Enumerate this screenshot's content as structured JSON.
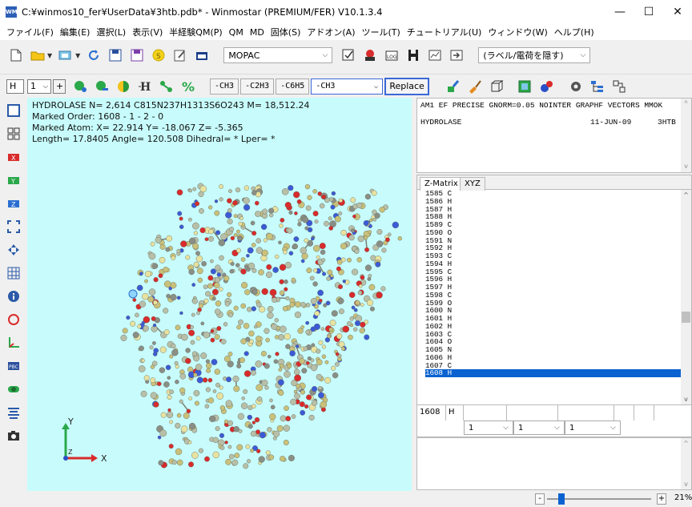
{
  "window": {
    "title": "C:¥winmos10_fer¥UserData¥3htb.pdb* - Winmostar (PREMIUM/FER) V10.1.3.4",
    "icon_label": "WM",
    "minimize_glyph": "—",
    "maximize_glyph": "☐",
    "close_glyph": "✕"
  },
  "menu": [
    "ファイル(F)",
    "編集(E)",
    "選択(L)",
    "表示(V)",
    "半経験QM(P)",
    "QM",
    "MD",
    "固体(S)",
    "アドオン(A)",
    "ツール(T)",
    "チュートリアル(U)",
    "ウィンドウ(W)",
    "ヘルプ(H)"
  ],
  "toolbar1": {
    "method_value": "MOPAC",
    "label_option": "(ラベル/電荷を隠す)"
  },
  "toolbar2": {
    "element_value": "H",
    "number_value": "1",
    "plus_label": "+",
    "group_buttons": [
      "-CH3",
      "-C2H3",
      "-C6H5"
    ],
    "group_select_value": "-CH3",
    "replace_label": "Replace"
  },
  "viewport": {
    "line1": "HYDROLASE  N= 2,614  C815N237H1313S6O243  M= 18,512.24",
    "line2": "Marked Order: 1608 - 1 - 2 - 0",
    "line3": "Marked Atom: X= 22.914  Y= -18.067  Z= -5.365",
    "line4": "Length= 17.8405  Angle= 120.508  Dihedral= * Lper= *",
    "axis_y": "Y",
    "axis_x": "X",
    "axis_z": "Z",
    "background": "#c8fcfc"
  },
  "mopac": {
    "keywords": "AM1 EF PRECISE GNORM=0.05 NOINTER GRAPHF VECTORS MMOK",
    "title_left": "HYDROLASE",
    "title_date": "11-JUN-09",
    "title_id": "3HTB"
  },
  "zmatrix": {
    "tab_zmatrix": "Z-Matrix",
    "tab_xyz": "XYZ",
    "rows": [
      "1585 C",
      "1586 H",
      "1587 H",
      "1588 H",
      "1589 C",
      "1590 O",
      "1591 N",
      "1592 H",
      "1593 C",
      "1594 H",
      "1595 C",
      "1596 H",
      "1597 H",
      "1598 C",
      "1599 O",
      "1600 N",
      "1601 H",
      "1602 H",
      "1603 C",
      "1604 O",
      "1605 N",
      "1606 H",
      "1607 C",
      "1608 H"
    ],
    "selected_index": 23,
    "edit_number": "1608",
    "edit_element": "H",
    "ref1": "1",
    "ref2": "1",
    "ref3": "1"
  },
  "status": {
    "zoom": "21%",
    "minus": "-",
    "plus": "+"
  }
}
